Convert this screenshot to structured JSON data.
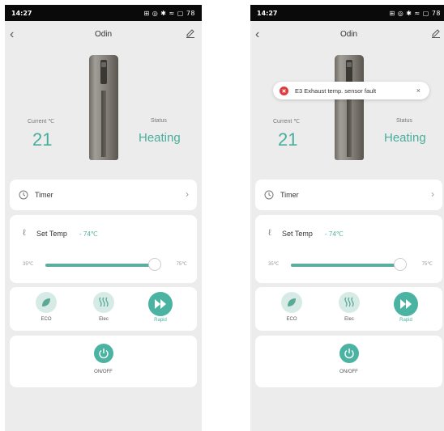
{
  "screens": [
    {
      "status_bar": {
        "time": "14:27",
        "icons": "⊞ ◎ ✱ ≈ ▢ 78",
        "battery": "78"
      },
      "header": {
        "title": "Odin",
        "back_icon": "chevron-left-icon",
        "edit_icon": "pencil-icon"
      },
      "current": {
        "label": "Current ℃",
        "value": "21"
      },
      "status": {
        "label": "Status",
        "value": "Heating"
      },
      "timer": {
        "label": "Timer"
      },
      "set_temp": {
        "label": "Set Temp",
        "value": "74℃",
        "min": "35℃",
        "max": "75℃",
        "level_fraction": 0.975
      },
      "modes": [
        {
          "label": "ECO",
          "icon": "leaf-icon",
          "active": false
        },
        {
          "label": "Elec",
          "icon": "heat-waves-icon",
          "active": false
        },
        {
          "label": "Rapid",
          "icon": "fast-forward-icon",
          "active": true
        }
      ],
      "power": {
        "label": "ON/OFF"
      }
    },
    {
      "status_bar": {
        "time": "14:27",
        "icons": "⊞ ◎ ✱ ≈ ▢ 78",
        "battery": "78"
      },
      "header": {
        "title": "Odin",
        "back_icon": "chevron-left-icon",
        "edit_icon": "pencil-icon"
      },
      "toast": {
        "message": "E3 Exhaust temp. sensor fault",
        "icon": "error-icon",
        "close": "×"
      },
      "current": {
        "label": "Current ℃",
        "value": "21"
      },
      "status": {
        "label": "Status",
        "value": "Heating"
      },
      "timer": {
        "label": "Timer"
      },
      "set_temp": {
        "label": "Set Temp",
        "value": "74℃",
        "min": "35℃",
        "max": "75℃",
        "level_fraction": 0.975
      },
      "modes": [
        {
          "label": "ECO",
          "icon": "leaf-icon",
          "active": false
        },
        {
          "label": "Elec",
          "icon": "heat-waves-icon",
          "active": false
        },
        {
          "label": "Rapid",
          "icon": "fast-forward-icon",
          "active": true
        }
      ],
      "power": {
        "label": "ON/OFF"
      }
    }
  ],
  "colors": {
    "accent": "#4bb3a2",
    "accent_light": "#d6ebe5",
    "error": "#e0393e",
    "background": "#ececec"
  }
}
